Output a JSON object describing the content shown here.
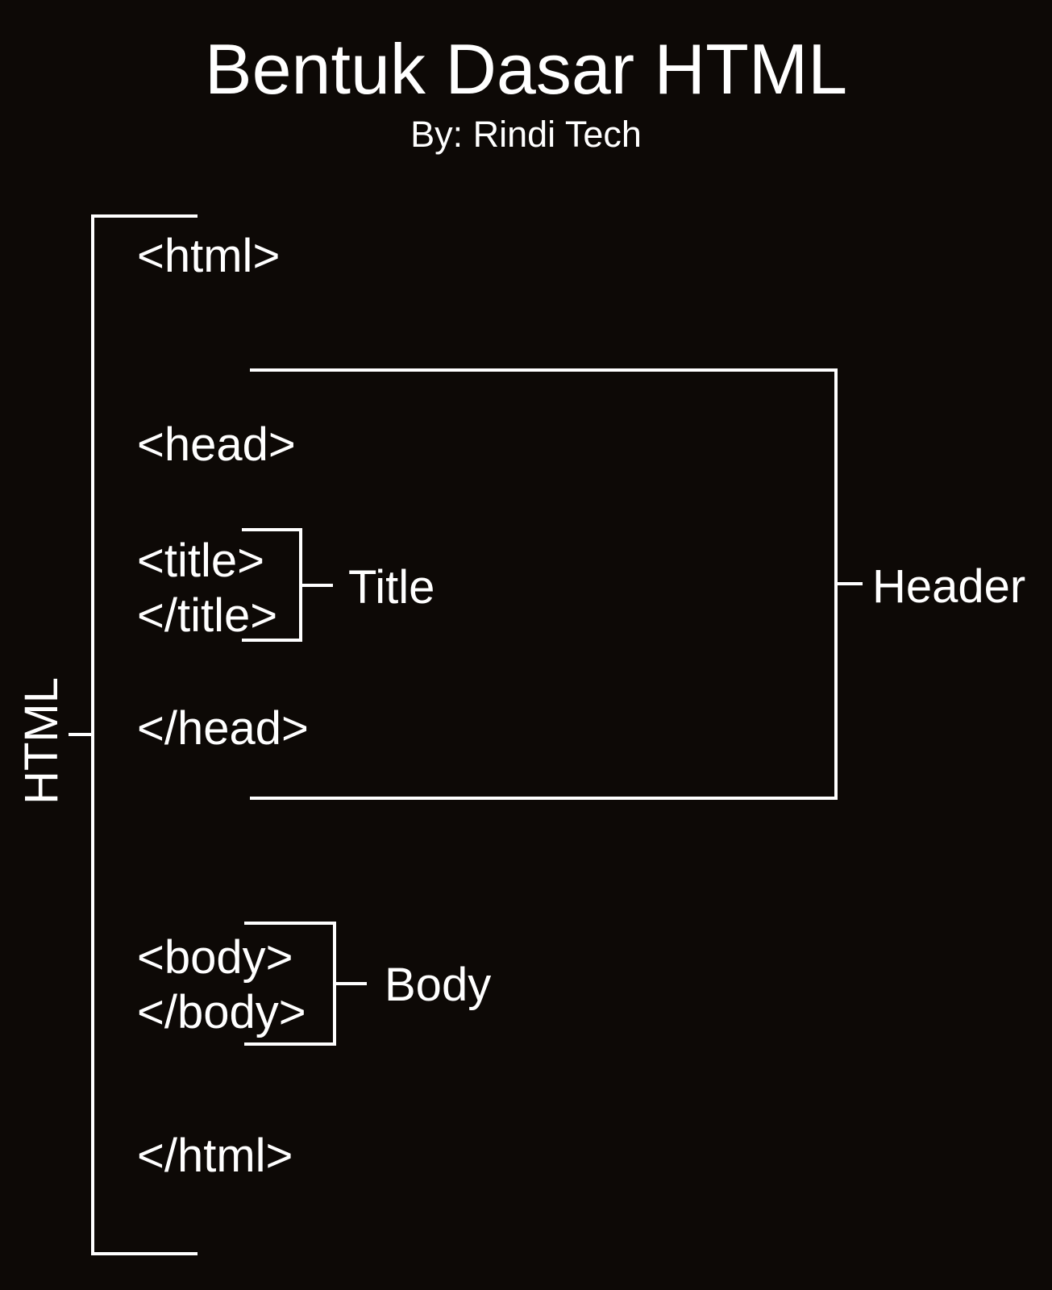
{
  "title": "Bentuk Dasar HTML",
  "subtitle": "By: Rindi Tech",
  "tags": {
    "html_open": "<html>",
    "html_close": "</html>",
    "head_open": "<head>",
    "head_close": "</head>",
    "title_open": "<title>",
    "title_close": "</title>",
    "body_open": "<body>",
    "body_close": "</body>"
  },
  "labels": {
    "html": "HTML",
    "header": "Header",
    "title": "Title",
    "body": "Body"
  }
}
